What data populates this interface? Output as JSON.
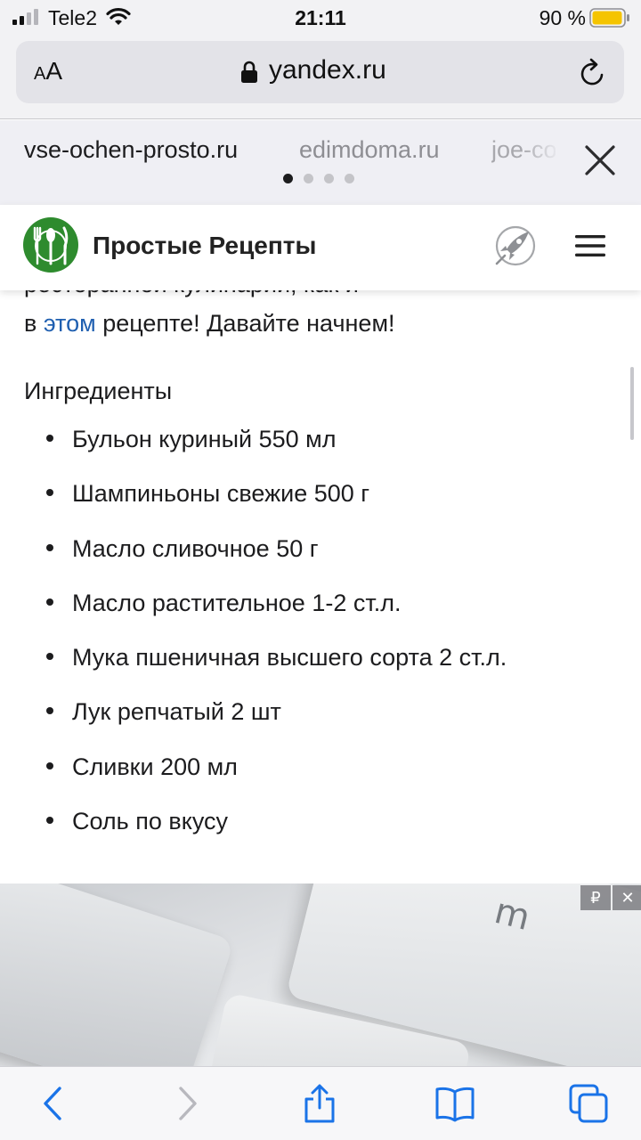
{
  "status_bar": {
    "carrier": "Tele2",
    "time": "21:11",
    "battery_percent": "90 %"
  },
  "browser": {
    "reader_button_small": "A",
    "reader_button_large": "A",
    "url": "yandex.ru"
  },
  "related_sites": {
    "items": [
      "vse-ochen-prosto.ru",
      "edimdoma.ru",
      "joe-cook"
    ],
    "active_index": 0,
    "page_count": 4
  },
  "site": {
    "title": "Простые Рецепты"
  },
  "article": {
    "cut_off_line": "ресторанной кулинарии, как и",
    "intro_prefix": "в ",
    "intro_link": "этом",
    "intro_suffix": " рецепте! Давайте начнем!",
    "ingredients_heading": "Ингредиенты",
    "ingredients": [
      "Бульон куриный 550 мл",
      "Шампиньоны свежие 500 г",
      "Масло сливочное 50 г",
      "Масло растительное 1-2 ст.л.",
      "Мука пшеничная высшего сорта 2 ст.л.",
      "Лук репчатый 2 шт",
      "Сливки 200 мл",
      "Соль  по вкусу"
    ]
  },
  "ad": {
    "currency_badge": "₽",
    "close_badge": "✕",
    "key_glyph": "m"
  },
  "colors": {
    "link": "#1f5fb0",
    "toolbar_active": "#1a73e8",
    "toolbar_disabled": "#b8b8be",
    "battery": "#f5c400",
    "logo_green": "#2e8b2e"
  },
  "icons": {
    "signal": "signal-icon",
    "wifi": "wifi-icon",
    "battery": "battery-icon",
    "lock": "lock-icon",
    "reload": "reload-icon",
    "close": "close-icon",
    "logo": "fork-spoon-plate-logo",
    "rocket": "rocket-icon",
    "menu": "hamburger-menu-icon",
    "back": "back-arrow-icon",
    "forward": "forward-arrow-icon",
    "share": "share-icon",
    "bookmarks": "bookmarks-icon",
    "tabs": "tabs-icon"
  }
}
